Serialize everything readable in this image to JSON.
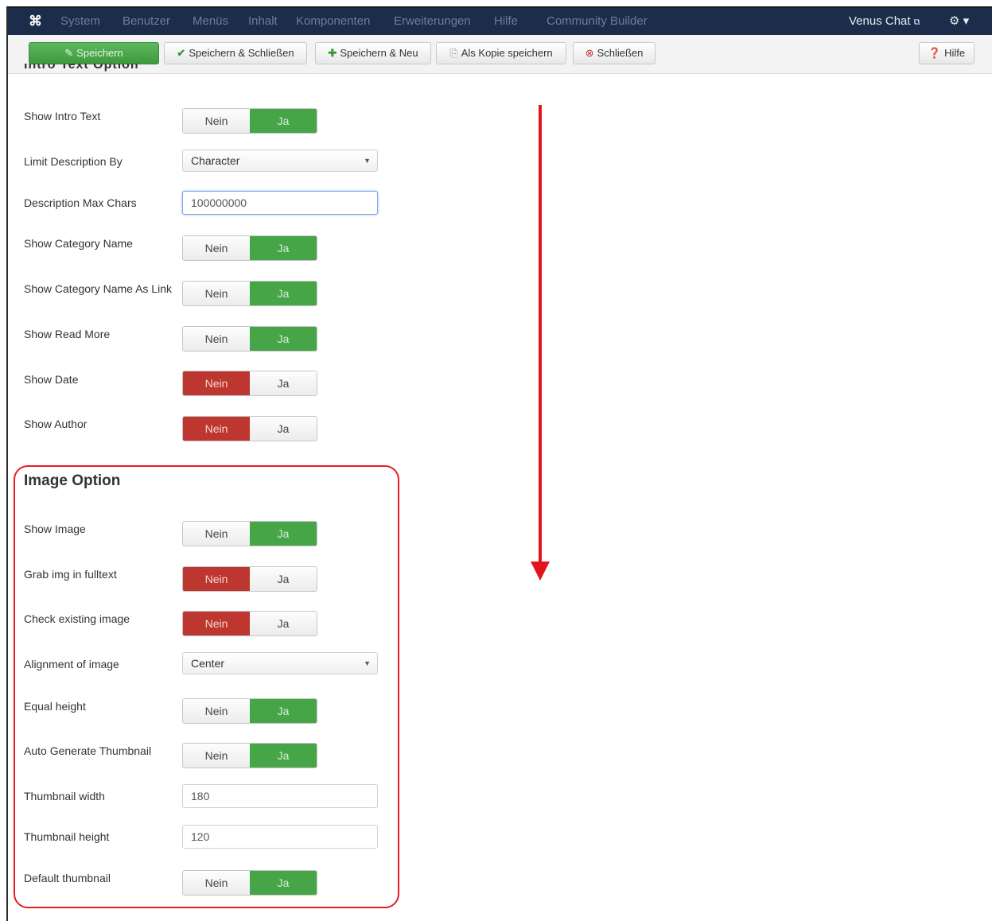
{
  "navbar": {
    "brand_icon": "joomla-logo-icon",
    "menus": [
      "System",
      "Benutzer",
      "Menüs",
      "Inhalt",
      "Komponenten",
      "Erweiterungen",
      "Hilfe",
      "Community Builder"
    ],
    "site_link": "Venus Chat",
    "settings_icon": "gear-icon"
  },
  "toolbar": {
    "save": "Speichern",
    "save_close": "Speichern & Schließen",
    "save_new": "Speichern & Neu",
    "save_copy": "Als Kopie speichern",
    "close": "Schließen",
    "help": "Hilfe"
  },
  "cut_heading": "Intro Text Option",
  "toggle_labels": {
    "off": "Nein",
    "on": "Ja"
  },
  "fields": [
    {
      "label": "Show Intro Text",
      "type": "toggle",
      "value": "Ja"
    },
    {
      "label": "Limit Description By",
      "type": "select",
      "value": "Character"
    },
    {
      "label": "Description Max Chars",
      "type": "input",
      "value": "100000000"
    },
    {
      "label": "Show Category Name",
      "type": "toggle",
      "value": "Ja"
    },
    {
      "label": "Show Category Name As Link",
      "type": "toggle",
      "value": "Ja"
    },
    {
      "label": "Show Read More",
      "type": "toggle",
      "value": "Ja"
    },
    {
      "label": "Show Date",
      "type": "toggle",
      "value": "Nein"
    },
    {
      "label": "Show Author",
      "type": "toggle",
      "value": "Nein"
    }
  ],
  "image_section": {
    "title": "Image Option",
    "fields": [
      {
        "label": "Show Image",
        "type": "toggle",
        "value": "Ja"
      },
      {
        "label": "Grab img in fulltext",
        "type": "toggle",
        "value": "Nein"
      },
      {
        "label": "Check existing image",
        "type": "toggle",
        "value": "Nein"
      },
      {
        "label": "Alignment of image",
        "type": "select",
        "value": "Center"
      },
      {
        "label": "Equal height",
        "type": "toggle",
        "value": "Ja"
      },
      {
        "label": "Auto Generate Thumbnail",
        "type": "toggle",
        "value": "Ja"
      },
      {
        "label": "Thumbnail width",
        "type": "input",
        "value": "180"
      },
      {
        "label": "Thumbnail height",
        "type": "input",
        "value": "120"
      },
      {
        "label": "Default thumbnail",
        "type": "toggle",
        "value": "Ja"
      }
    ]
  },
  "colors": {
    "navbar": "#1b2d4a",
    "toggle_on_green": "#46a546",
    "toggle_on_red": "#bd362f",
    "annotation_red": "#e81c24"
  }
}
